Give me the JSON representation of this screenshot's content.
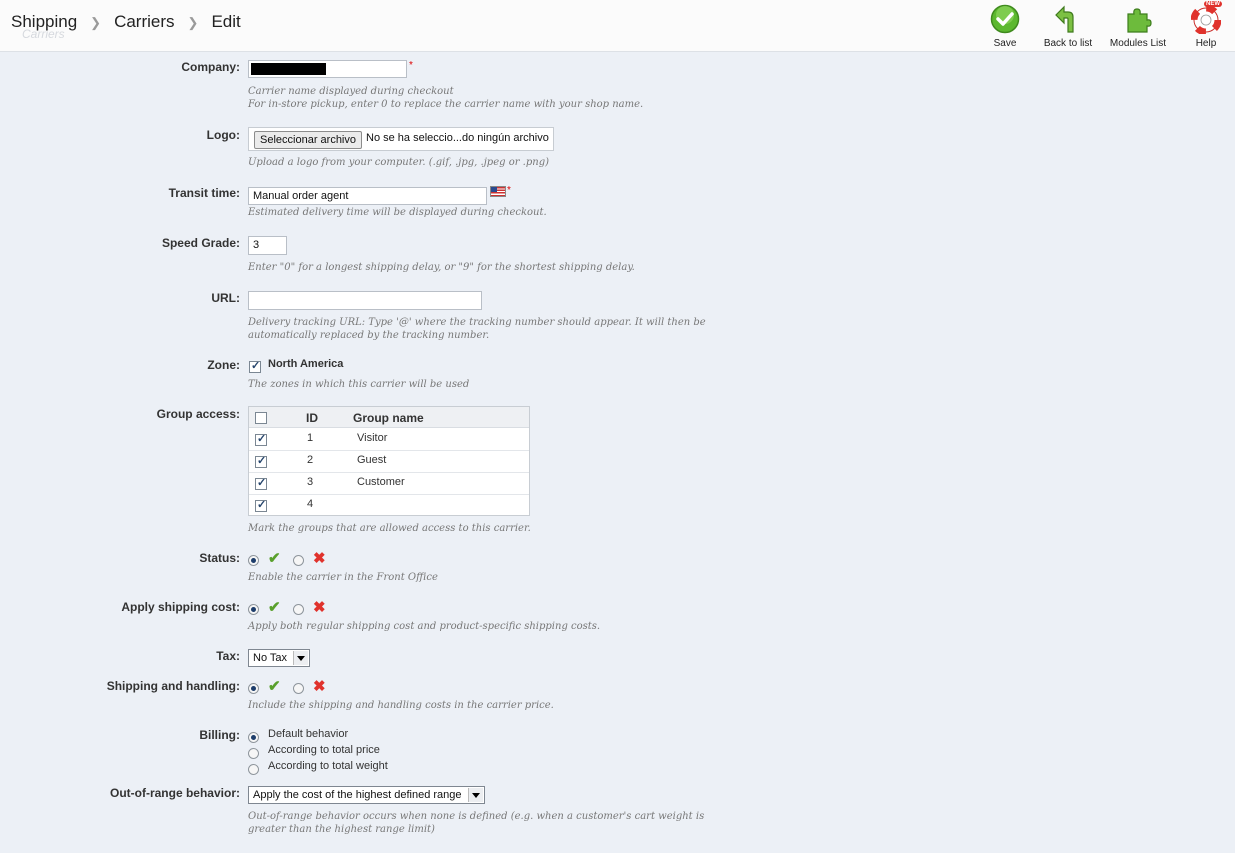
{
  "breadcrumb": {
    "items": [
      "Shipping",
      "Carriers",
      "Edit"
    ],
    "ghost": "Carriers"
  },
  "toolbar": {
    "save": "Save",
    "back": "Back to list",
    "modules": "Modules List",
    "help": "Help",
    "help_badge": "NEW"
  },
  "company": {
    "label": "Company:",
    "hint1": "Carrier name displayed during checkout",
    "hint2": "For in-store pickup, enter 0 to replace the carrier name with your shop name."
  },
  "logo": {
    "label": "Logo:",
    "button": "Seleccionar archivo",
    "status": "No se ha seleccio...do ningún archivo",
    "hint": "Upload a logo from your computer. (.gif, .jpg, .jpeg or .png)"
  },
  "transit": {
    "label": "Transit time:",
    "value": "Manual order agent",
    "hint": "Estimated delivery time will be displayed during checkout."
  },
  "speed": {
    "label": "Speed Grade:",
    "value": "3",
    "hint": "Enter \"0\" for a longest shipping delay, or \"9\" for the shortest shipping delay."
  },
  "url": {
    "label": "URL:",
    "value": "",
    "hint1": "Delivery tracking URL: Type '@' where the tracking number should appear. It will then be",
    "hint2": "automatically replaced by the tracking number."
  },
  "zone": {
    "label": "Zone:",
    "option": "North America",
    "checked": true,
    "hint": "The zones in which this carrier will be used"
  },
  "groups": {
    "label": "Group access:",
    "col_id": "ID",
    "col_name": "Group name",
    "rows": [
      {
        "id": "1",
        "name": "Visitor",
        "checked": true
      },
      {
        "id": "2",
        "name": "Guest",
        "checked": true
      },
      {
        "id": "3",
        "name": "Customer",
        "checked": true
      },
      {
        "id": "4",
        "name": "",
        "checked": true
      }
    ],
    "hint": "Mark the groups that are allowed access to this carrier."
  },
  "status": {
    "label": "Status:",
    "hint": "Enable the carrier in the Front Office",
    "value": "yes"
  },
  "shipping_cost": {
    "label": "Apply shipping cost:",
    "hint": "Apply both regular shipping cost and product-specific shipping costs.",
    "value": "yes"
  },
  "tax": {
    "label": "Tax:",
    "value": "No Tax"
  },
  "handling": {
    "label": "Shipping and handling:",
    "hint": "Include the shipping and handling costs in the carrier price.",
    "value": "yes"
  },
  "billing": {
    "label": "Billing:",
    "options": [
      "Default behavior",
      "According to total price",
      "According to total weight"
    ],
    "selected": 0
  },
  "range": {
    "label": "Out-of-range behavior:",
    "value": "Apply the cost of the highest defined range",
    "hint1": "Out-of-range behavior occurs when none is defined (e.g. when a customer's cart weight is",
    "hint2": "greater than the highest range limit)"
  },
  "colors": {
    "save_green": "#4caf2a",
    "cross_red": "#e0322c",
    "check_green": "#59a02c"
  }
}
